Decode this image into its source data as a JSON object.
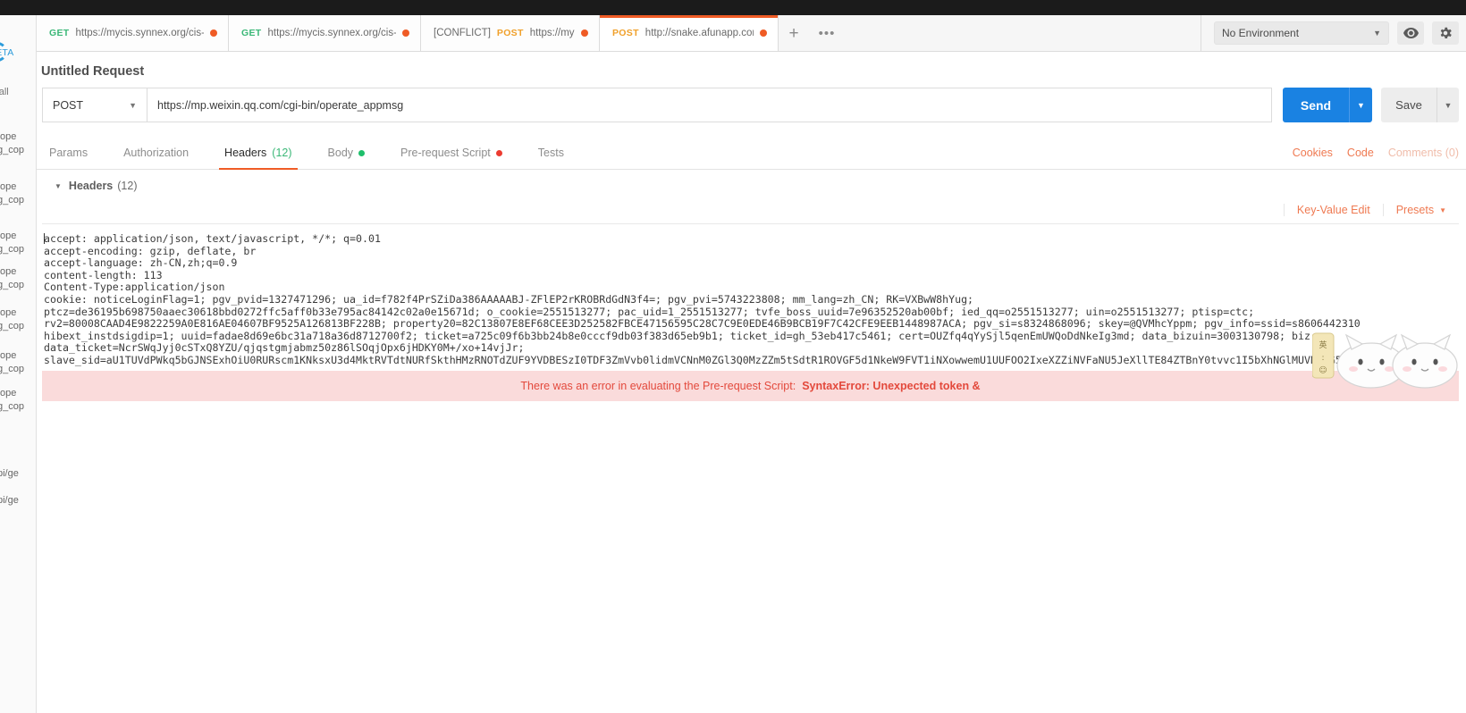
{
  "window": {
    "top_strip_color": "#1b1b1b"
  },
  "far_sidebar": {
    "beta_label": "BETA",
    "all_label": "r all",
    "items": [
      "/ope",
      "g_cop",
      "/ope",
      "g_cop",
      "/ope",
      "g_cop",
      "/ope",
      "g_cop",
      "/ope",
      "g_cop",
      "/ope",
      "g_cop",
      "/ope",
      "g_cop",
      "pi/ge",
      "pi/ge"
    ]
  },
  "tabstrip": {
    "tabs": [
      {
        "verb": "GET",
        "verb_class": "get",
        "conflict": "",
        "label": "https://mycis.synnex.org/cis-cr/...",
        "unsaved": true,
        "active": false
      },
      {
        "verb": "GET",
        "verb_class": "get",
        "conflict": "",
        "label": "https://mycis.synnex.org/cis-cr/...",
        "unsaved": true,
        "active": false
      },
      {
        "verb": "POST",
        "verb_class": "post",
        "conflict": "[CONFLICT]",
        "label": "https://mycis.synn...",
        "unsaved": true,
        "active": false
      },
      {
        "verb": "POST",
        "verb_class": "post",
        "conflict": "",
        "label": "http://snake.afunapp.com/cla...",
        "unsaved": true,
        "active": true
      }
    ],
    "new_tab_icon": "plus-icon",
    "new_tab_glyph": "+",
    "more_icon": "ellipsis-icon",
    "more_glyph": "•••",
    "environment": {
      "selected": "No Environment",
      "caret": "▼",
      "eye_icon": "eye-icon",
      "settings_icon": "gear-icon"
    }
  },
  "request": {
    "title": "Untitled Request",
    "method": "POST",
    "method_caret": "▼",
    "url": "https://mp.weixin.qq.com/cgi-bin/operate_appmsg",
    "send_label": "Send",
    "send_caret": "▼",
    "send_color": "#1a82e2",
    "save_label": "Save",
    "save_caret": "▼"
  },
  "section_tabs": {
    "items": [
      {
        "label": "Params",
        "count": "",
        "dot": "",
        "active": false
      },
      {
        "label": "Authorization",
        "count": "",
        "dot": "",
        "active": false
      },
      {
        "label": "Headers",
        "count": "(12)",
        "dot": "",
        "active": true
      },
      {
        "label": "Body",
        "count": "",
        "dot": "green",
        "active": false
      },
      {
        "label": "Pre-request Script",
        "count": "",
        "dot": "red",
        "active": false
      },
      {
        "label": "Tests",
        "count": "",
        "dot": "",
        "active": false
      }
    ],
    "right_links": [
      {
        "label": "Cookies",
        "muted": false
      },
      {
        "label": "Code",
        "muted": false
      },
      {
        "label": "Comments (0)",
        "muted": true
      }
    ],
    "active_underline_color": "#ef5b25"
  },
  "headers_section": {
    "collapse_triangle": "▼",
    "title": "Headers",
    "count": "(12)",
    "key_value_edit_label": "Key-Value Edit",
    "presets_label": "Presets",
    "presets_caret": "▼",
    "bulk_text": "accept: application/json, text/javascript, */*; q=0.01\naccept-encoding: gzip, deflate, br\naccept-language: zh-CN,zh;q=0.9\ncontent-length: 113\nContent-Type:application/json\ncookie: noticeLoginFlag=1; pgv_pvid=1327471296; ua_id=f782f4PrSZiDa386AAAAABJ-ZFlEP2rKROBRdGdN3f4=; pgv_pvi=5743223808; mm_lang=zh_CN; RK=VXBwW8hYug;\nptcz=de36195b698750aaec30618bbd0272ffc5aff0b33e795ac84142c02a0e15671d; o_cookie=2551513277; pac_uid=1_2551513277; tvfe_boss_uuid=7e96352520ab00bf; ied_qq=o2551513277; uin=o2551513277; ptisp=ctc;\nrv2=80008CAAD4E9822259A0E816AE04607BF9525A126813BF228B; property20=82C13807E8EF68CEE3D252582FBCE47156595C28C7C9E0EDE46B9BCB19F7C42CFE9EEB1448987ACA; pgv_si=s8324868096; skey=@QVMhcYppm; pgv_info=ssid=s8606442310\nhibext_instdsigdip=1; uuid=fadae8d69e6bc31a718a36d8712700f2; ticket=a725c09f6b3bb24b8e0cccf9db03f383d65eb9b1; ticket_id=gh_53eb417c5461; cert=OUZfq4qYySjl5qenEmUWQoDdNkeIg3md; data_bizuin=3003130798; biz\ndata_ticket=NcrSWqJyj0cSTxQ8YZU/qjqstgmjabmz50z86lSOqjOpx6jHDKY0M+/xo+14vjJr;\nslave_sid=aU1TUVdPWkq5bGJNSExhOiU0RURscm1KNksxU3d4MktRVTdtNURfSkthHMzRNOTdZUF9YVDBESzI0TDF3ZmVvb0lidmVCNnM0ZGl3Q0MzZZm5tSdtR1ROVGF5d1NkeW9FVT1iNXowwemU1UUFOO2IxeXZZiNVFaNU5JeXllTE84ZTBnY0tvvc1I5bXhNGlMUVNQbG5Ek:"
  },
  "error_banner": {
    "message": "There was an error in evaluating the Pre-request Script:",
    "detail": "SyntaxError: Unexpected token &",
    "background": "#fadbdb",
    "text_color": "#e3493c"
  }
}
